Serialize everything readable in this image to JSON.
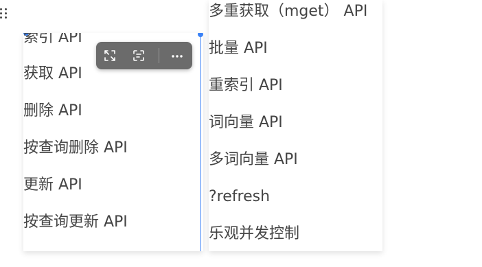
{
  "left_list": {
    "items": [
      "索引 API",
      "获取 API",
      "删除 API",
      "按查询删除 API",
      "更新 API",
      "按查询更新 API"
    ]
  },
  "right_list": {
    "items": [
      "多重获取（mget） API",
      "批量 API",
      "重索引 API",
      "词向量 API",
      "多词向量 API",
      "?refresh",
      "乐观并发控制"
    ]
  },
  "toolbar": {
    "icons": [
      "expand-icon",
      "scan-text-icon",
      "more-icon"
    ]
  },
  "colors": {
    "text": "#444444",
    "accent": "#3b82f6",
    "toolbar_bg": "#6b6b6b"
  }
}
